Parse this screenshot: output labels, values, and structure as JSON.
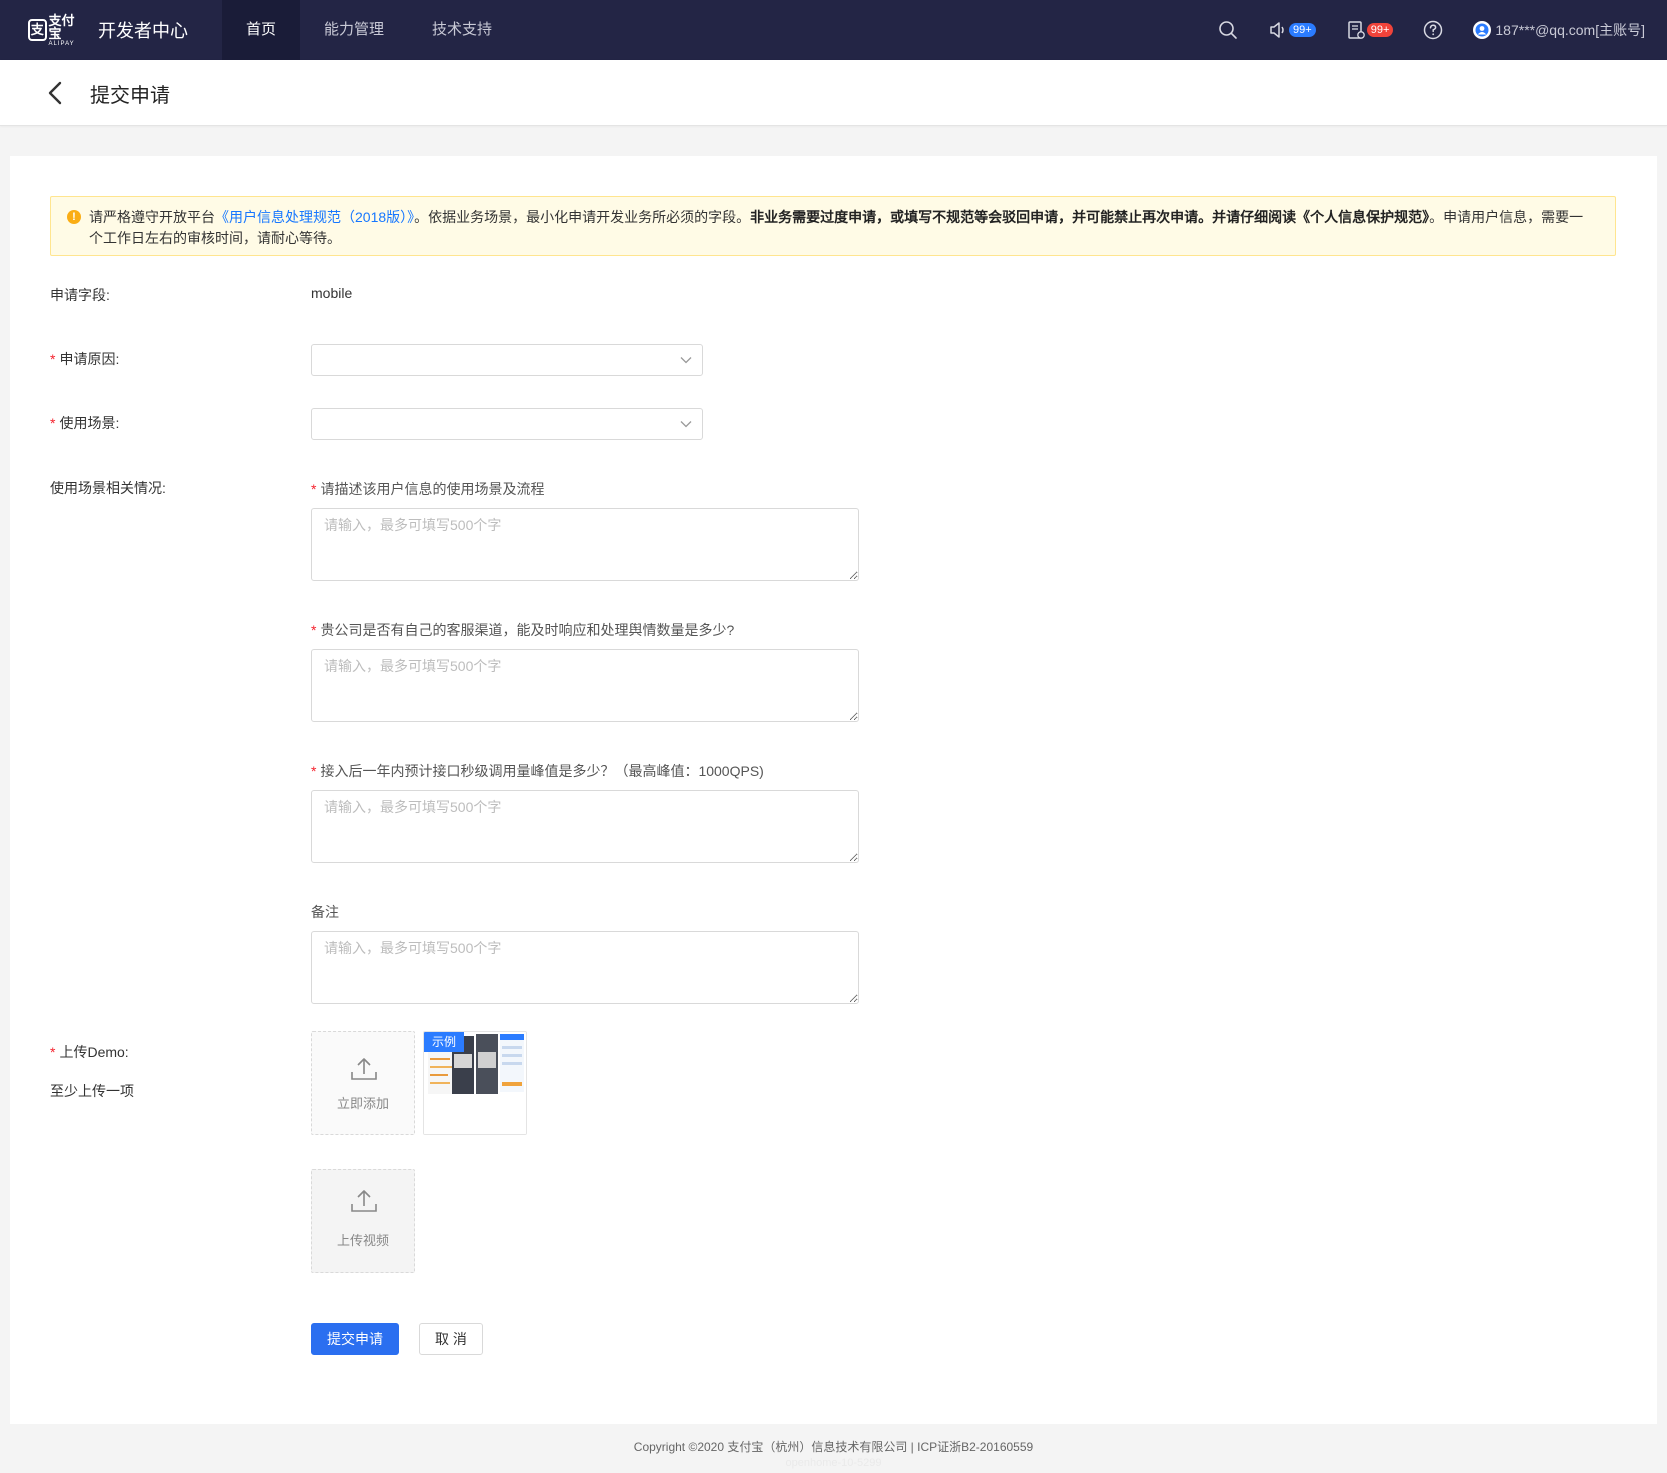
{
  "nav": {
    "brand_cn": "支付宝",
    "brand_en": "ALIPAY",
    "brand_mark": "支",
    "title": "开发者中心",
    "tabs": [
      {
        "label": "首页",
        "active": true
      },
      {
        "label": "能力管理",
        "active": false
      },
      {
        "label": "技术支持",
        "active": false
      }
    ],
    "icons": {
      "search": "search-icon",
      "announcement": "speaker-icon",
      "messages": "document-icon",
      "help": "question-icon"
    },
    "announcement_badge": "99+",
    "message_badge": "99+",
    "account": "187***@qq.com[主账号]"
  },
  "header": {
    "back_icon": "chevron-left-icon",
    "title": "提交申请"
  },
  "notice": {
    "prefix": "请严格遵守开放平台",
    "link": "《用户信息处理规范（2018版）》",
    "middle": "。依据业务场景，最小化申请开发业务所必须的字段。",
    "bold": "非业务需要过度申请，或填写不规范等会驳回申请，并可能禁止再次申请。并请仔细阅读《个人信息保护规范》",
    "suffix": "。申请用户信息，需要一个工作日左右的审核时间，请耐心等待。"
  },
  "form": {
    "field_label": "申请字段:",
    "field_value": "mobile",
    "reason_label": "申请原因:",
    "reason_value": "",
    "scene_label": "使用场景:",
    "scene_value": "",
    "scene_detail_label": "使用场景相关情况:",
    "required_mark": "*",
    "questions": [
      {
        "label": "请描述该用户信息的使用场景及流程",
        "required": true,
        "placeholder": "请输入，最多可填写500个字"
      },
      {
        "label": "贵公司是否有自己的客服渠道，能及时响应和处理舆情数量是多少?",
        "required": true,
        "placeholder": "请输入，最多可填写500个字"
      },
      {
        "label": "接入后一年内预计接口秒级调用量峰值是多少？（最高峰值：1000QPS)",
        "required": true,
        "placeholder": "请输入，最多可填写500个字"
      },
      {
        "label": "备注",
        "required": false,
        "placeholder": "请输入，最多可填写500个字"
      }
    ],
    "demo_label": "上传Demo:",
    "demo_hint": "至少上传一项",
    "upload_add": "立即添加",
    "example_tag": "示例",
    "upload_video": "上传视频",
    "submit": "提交申请",
    "cancel": "取 消"
  },
  "footer": {
    "copyright": "Copyright ©2020 支付宝（杭州）信息技术有限公司 | ICP证浙B2-20160559",
    "sub": "openhome-10-5299"
  }
}
